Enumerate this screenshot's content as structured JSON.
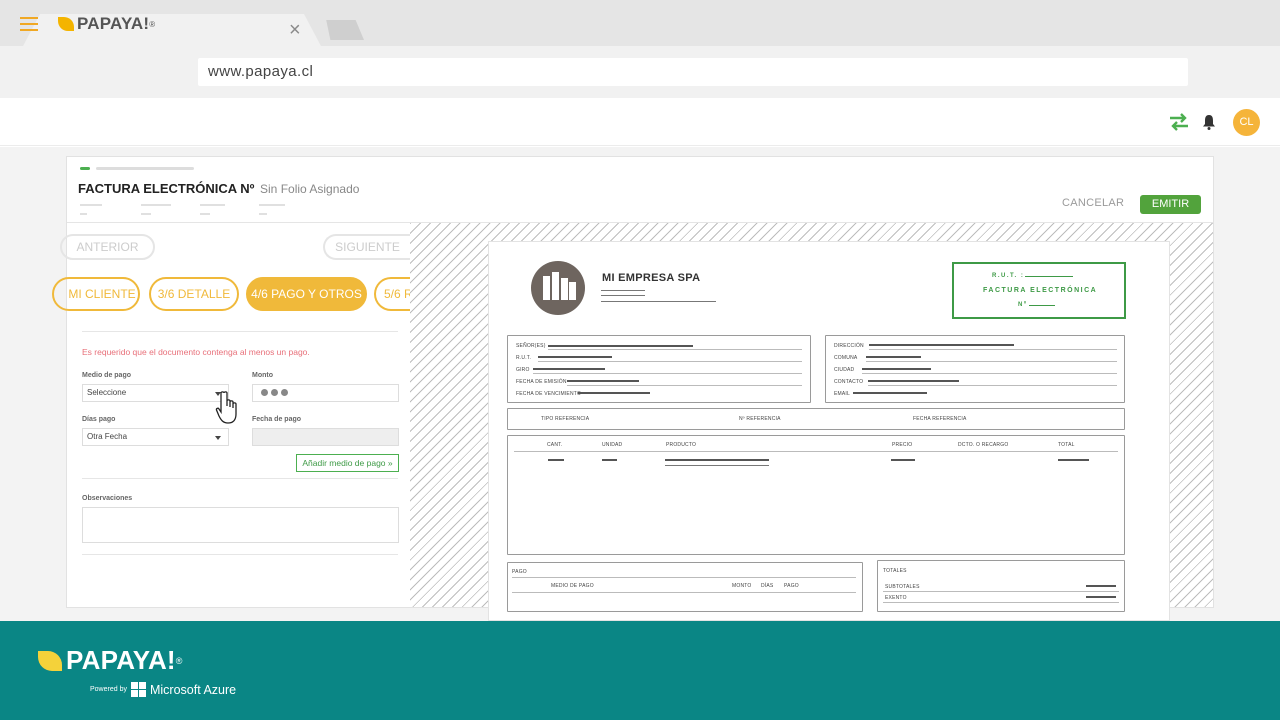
{
  "browser": {
    "url": "www.papaya.cl",
    "tab_close": "×"
  },
  "app": {
    "logo_text": "PAPAYA!",
    "logo_reg": "®",
    "avatar_initials": "CL"
  },
  "invoice_header": {
    "title": "FACTURA ELECTRÓNICA Nº",
    "subtitle": "Sin Folio Asignado",
    "cancel_label": "CANCELAR",
    "emit_label": "EMITIR"
  },
  "wizard": {
    "prev_label": "ANTERIOR",
    "next_label": "SIGUIENTE",
    "steps": [
      {
        "label": "MI CLIENTE"
      },
      {
        "label": "3/6 DETALLE"
      },
      {
        "label": "4/6 PAGO Y OTROS"
      },
      {
        "label": "5/6 R"
      }
    ]
  },
  "payment_form": {
    "error": "Es requerido que el documento contenga al menos un pago.",
    "medio_label": "Medio de pago",
    "medio_value": "Seleccione",
    "monto_label": "Monto",
    "dias_label": "Días pago",
    "dias_value": "Otra Fecha",
    "fecha_label": "Fecha de pago",
    "add_button": "Añadir medio de pago »",
    "obs_label": "Observaciones"
  },
  "preview": {
    "company_name": "MI EMPRESA SPA",
    "rut_label": "R.U.T. :",
    "doc_type": "FACTURA ELECTRÓNICA",
    "num_label": "Nº",
    "client_fields": [
      "SEÑOR(ES)",
      "R.U.T.",
      "GIRO",
      "FECHA DE EMISIÓN",
      "FECHA DE VENCIMIENTO"
    ],
    "address_fields": [
      "DIRECCIÓN",
      "COMUNA",
      "CIUDAD",
      "CONTACTO",
      "EMAIL"
    ],
    "reference_headers": [
      "TIPO REFERENCIA",
      "Nº REFERENCIA",
      "FECHA REFERENCIA"
    ],
    "item_headers": [
      "CANT.",
      "UNIDAD",
      "PRODUCTO",
      "PRECIO",
      "DCTO. O RECARGO",
      "TOTAL"
    ],
    "payment_title": "PAGO",
    "payment_headers": [
      "MEDIO DE PAGO",
      "MONTO",
      "DÍAS",
      "PAGO"
    ],
    "totals_title": "TOTALES",
    "totals_rows": [
      "SUBTOTALES",
      "EXENTO"
    ]
  },
  "footer": {
    "logo_text": "PAPAYA!",
    "logo_reg": "®",
    "powered_by": "Powered by",
    "partner": "Microsoft Azure"
  },
  "colors": {
    "brand_yellow": "#f0b93a",
    "brand_green": "#52a33c",
    "footer_teal": "#0a8685",
    "error_red": "#e8707a"
  },
  "icons": {
    "menu": "hamburger-icon",
    "sync": "transfer-arrows-icon",
    "notifications": "bell-icon",
    "cursor": "hand-pointer-icon",
    "partner": "windows-logo-icon"
  }
}
